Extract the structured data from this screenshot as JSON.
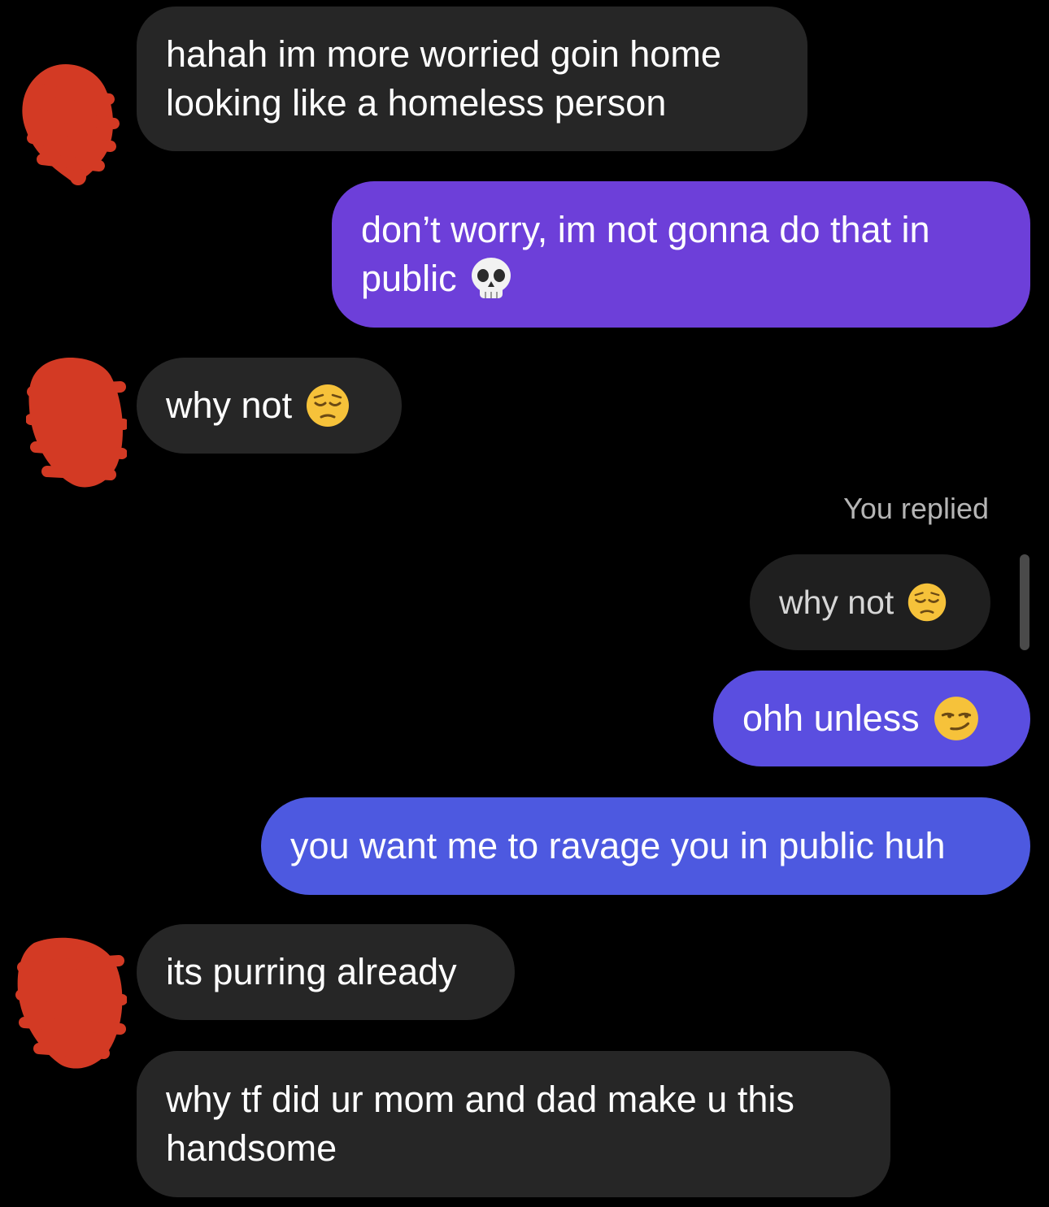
{
  "conversation": {
    "messages": [
      {
        "id": "m1",
        "direction": "incoming",
        "text_line1": "hahah im more worried goin home",
        "text_line2": "looking like a homeless person"
      },
      {
        "id": "m2",
        "direction": "outgoing",
        "text_line1": "don’t worry, im not gonna do that in",
        "text_line2": "public",
        "emoji": "skull-emoji"
      },
      {
        "id": "m3",
        "direction": "incoming",
        "text": "why not",
        "emoji": "pensive-face-emoji"
      },
      {
        "id": "m4",
        "direction": "outgoing-reply",
        "reply_label": "You replied",
        "quoted_text": "why not",
        "quoted_emoji": "pensive-face-emoji"
      },
      {
        "id": "m5",
        "direction": "outgoing",
        "text": "ohh unless",
        "emoji": "smirking-face-emoji"
      },
      {
        "id": "m6",
        "direction": "outgoing",
        "text": "you want me to ravage you in public huh"
      },
      {
        "id": "m7",
        "direction": "incoming",
        "text": "its purring already"
      },
      {
        "id": "m8",
        "direction": "incoming",
        "text_line1": "why tf did ur mom and dad make u this",
        "text_line2": "handsome"
      }
    ]
  },
  "colors": {
    "background": "#000000",
    "incoming_bubble": "#262626",
    "outgoing_purple": "#6d3fd9",
    "outgoing_indigo": "#5a4ee0",
    "outgoing_blue": "#4d59e0",
    "avatar_redaction": "#d33a24"
  }
}
